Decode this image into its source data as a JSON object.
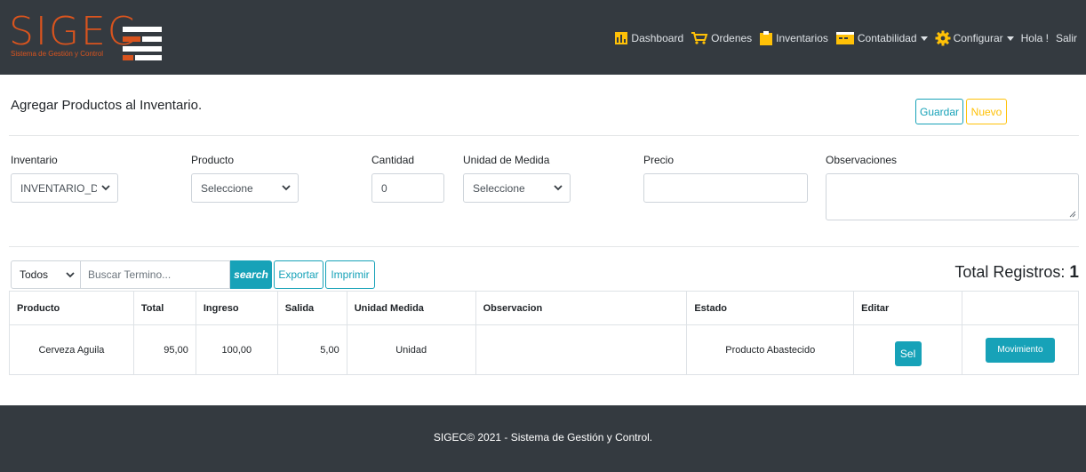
{
  "brand": {
    "name": "SIGEC",
    "subtitle": "Sistema de Gestión y Control",
    "color": "#d9541e"
  },
  "nav": {
    "dashboard": "Dashboard",
    "ordenes": "Ordenes",
    "inventarios": "Inventarios",
    "contabilidad": "Contabilidad",
    "configurar": "Configurar",
    "greeting": "Hola !",
    "salir": "Salir"
  },
  "page": {
    "title": "Agregar Productos al Inventario.",
    "guardar": "Guardar",
    "nuevo": "Nuevo"
  },
  "form": {
    "inventario": {
      "label": "Inventario",
      "value": "INVENTARIO_DEFA"
    },
    "producto": {
      "label": "Producto",
      "value": "Seleccione"
    },
    "cantidad": {
      "label": "Cantidad",
      "value": "0"
    },
    "unidad": {
      "label": "Unidad de Medida",
      "value": "Seleccione"
    },
    "precio": {
      "label": "Precio",
      "value": ""
    },
    "observaciones": {
      "label": "Observaciones",
      "value": ""
    }
  },
  "toolbar": {
    "filter": "Todos",
    "search_placeholder": "Buscar Termino...",
    "search_button": "search",
    "export_button": "Exportar",
    "print_button": "Imprimir",
    "total_label": "Total Registros:",
    "total_value": "1"
  },
  "table": {
    "headers": [
      "Producto",
      "Total",
      "Ingreso",
      "Salida",
      "Unidad Medida",
      "Observacion",
      "Estado",
      "Editar",
      ""
    ],
    "rows": [
      {
        "producto": "Cerveza Aguila",
        "total": "95,00",
        "ingreso": "100,00",
        "salida": "5,00",
        "unidad": "Unidad",
        "observacion": "",
        "estado": "Producto Abastecido",
        "editar": "Sel",
        "movimiento": "Movimiento"
      }
    ]
  },
  "footer": {
    "text": "SIGEC© 2021 - Sistema de Gestión y Control."
  },
  "colors": {
    "navbar": "#343a40",
    "info": "#17a2b8",
    "warning": "#ffc107"
  }
}
